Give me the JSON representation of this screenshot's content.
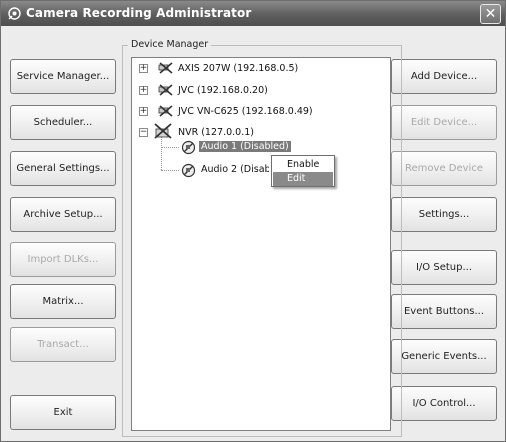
{
  "window": {
    "title": "Camera Recording Administrator",
    "close_glyph": "✕"
  },
  "left_buttons": [
    {
      "label": "Service Manager...",
      "enabled": true
    },
    {
      "label": "Scheduler...",
      "enabled": true
    },
    {
      "label": "General Settings...",
      "enabled": true
    },
    {
      "label": "Archive Setup...",
      "enabled": true
    },
    {
      "label": "Import DLKs...",
      "enabled": false
    },
    {
      "label": "Matrix...",
      "enabled": true
    },
    {
      "label": "Transact...",
      "enabled": false
    },
    {
      "label": "Exit",
      "enabled": true
    }
  ],
  "right_buttons": [
    {
      "label": "Add Device...",
      "enabled": true
    },
    {
      "label": "Edit Device...",
      "enabled": false
    },
    {
      "label": "Remove Device",
      "enabled": false
    },
    {
      "label": "Settings...",
      "enabled": true
    },
    {
      "label": "I/O Setup...",
      "enabled": true
    },
    {
      "label": "Event Buttons...",
      "enabled": true
    },
    {
      "label": "Generic Events...",
      "enabled": true
    },
    {
      "label": "I/O Control...",
      "enabled": true
    }
  ],
  "device_manager": {
    "label": "Device Manager",
    "tree": [
      {
        "label": "AXIS 207W (192.168.0.5)",
        "expander": "+",
        "icon": "camera-device-icon"
      },
      {
        "label": "JVC  (192.168.0.20)",
        "expander": "+",
        "icon": "camera-device-icon"
      },
      {
        "label": "JVC VN-C625 (192.168.0.49)",
        "expander": "+",
        "icon": "camera-device-icon"
      },
      {
        "label": "NVR (127.0.0.1)",
        "expander": "−",
        "icon": "nvr-device-icon",
        "children": [
          {
            "label": "Audio 1 (Disabled)",
            "icon": "audio-disabled-icon",
            "selected": true
          },
          {
            "label": "Audio 2 (Disabled)",
            "icon": "audio-disabled-icon",
            "selected": false
          }
        ]
      }
    ]
  },
  "context_menu": {
    "items": [
      {
        "label": "Enable",
        "highlighted": false
      },
      {
        "label": "Edit",
        "highlighted": true
      }
    ]
  }
}
